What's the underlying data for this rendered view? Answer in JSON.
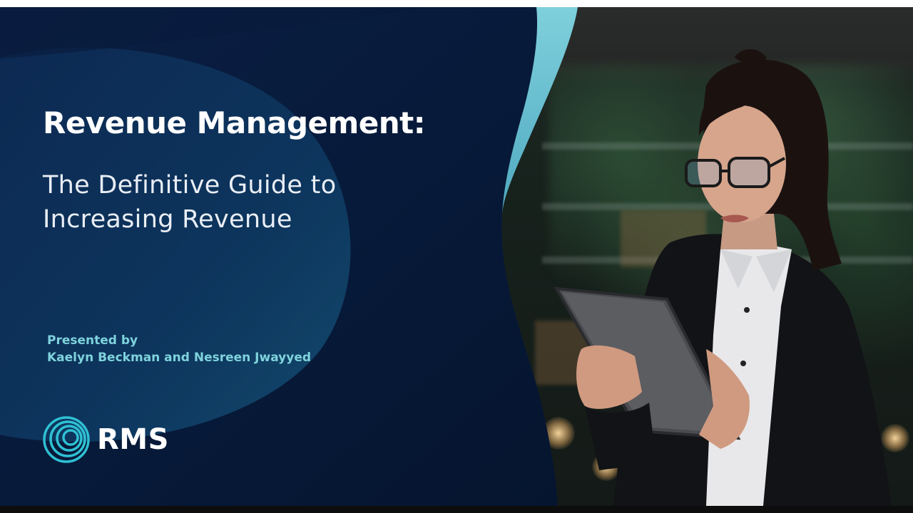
{
  "slide": {
    "title": "Revenue Management:",
    "subtitle_lines": [
      "The Definitive Guide to",
      "Increasing Revenue"
    ],
    "presented_label": "Presented by",
    "presenters": "Kaelyn Beckman and Nesreen Jwayyed",
    "brand_name": "RMS"
  },
  "colors": {
    "navy": "#081a3a",
    "navy_dark": "#05152f",
    "teal_accent": "#7fd3dd",
    "wave_light": "#6fc3d2"
  },
  "icons": {
    "logo": "rms-concentric-rings-icon"
  }
}
